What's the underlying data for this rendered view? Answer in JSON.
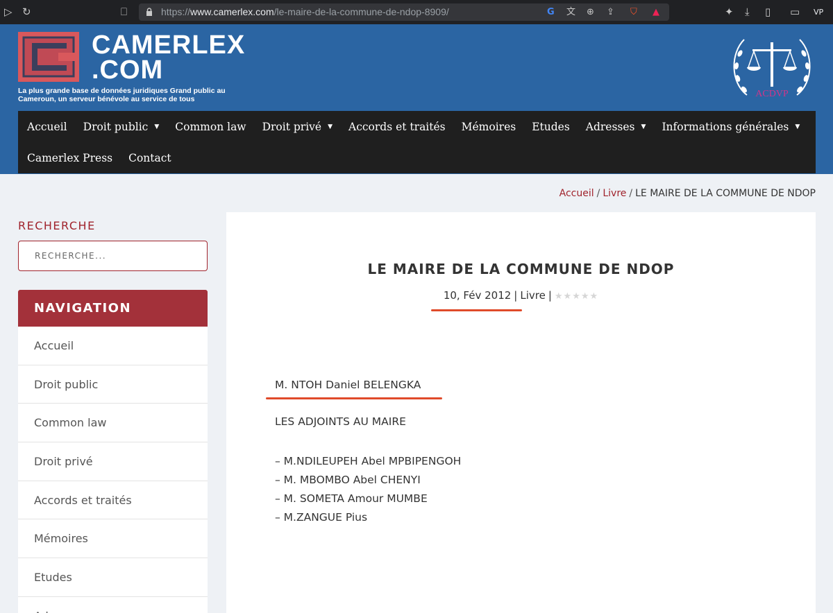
{
  "browser": {
    "url_prefix": "https://",
    "url_domain": "www.camerlex.com",
    "url_path": "/le-maire-de-la-commune-de-ndop-8909/",
    "profile_label": "VP"
  },
  "header": {
    "logo_line1": "CAMERLEX",
    "logo_line2": ".COM",
    "tagline": "La plus grande base de données juridiques Grand public au Cameroun, un serveur bénévole au service de tous",
    "seal_text": "ACDVP"
  },
  "nav": {
    "row1": [
      {
        "label": "Accueil",
        "dropdown": false
      },
      {
        "label": "Droit public",
        "dropdown": true
      },
      {
        "label": "Common law",
        "dropdown": false
      },
      {
        "label": "Droit privé",
        "dropdown": true
      },
      {
        "label": "Accords et traités",
        "dropdown": false
      },
      {
        "label": "Mémoires",
        "dropdown": false
      },
      {
        "label": "Etudes",
        "dropdown": false
      },
      {
        "label": "Adresses",
        "dropdown": true
      },
      {
        "label": "Informations générales",
        "dropdown": true
      }
    ],
    "row2": [
      {
        "label": "Camerlex Press",
        "dropdown": false
      },
      {
        "label": "Contact",
        "dropdown": false
      }
    ]
  },
  "breadcrumb": {
    "home": "Accueil",
    "category": "Livre",
    "separator": "/",
    "current": "LE MAIRE DE LA COMMUNE DE NDOP"
  },
  "sidebar": {
    "search_heading": "RECHERCHE",
    "search_placeholder": "RECHERCHE...",
    "nav_heading": "NAVIGATION",
    "items": [
      "Accueil",
      "Droit public",
      "Common law",
      "Droit privé",
      "Accords et traités",
      "Mémoires",
      "Etudes",
      "Adresses"
    ]
  },
  "article": {
    "title": "LE MAIRE DE LA COMMUNE DE NDOP",
    "date": "10, Fév 2012",
    "category": "Livre",
    "meta_separator": "|",
    "rating": {
      "value": 0,
      "max": 5
    },
    "mayor": "M. NTOH Daniel BELENGKA",
    "deputies_heading": "LES ADJOINTS AU MAIRE",
    "deputies": [
      "– M.NDILEUPEH Abel MPBIPENGOH",
      "– M. MBOMBO Abel CHENYI",
      "– M. SOMETA Amour MUMBE",
      "– M.ZANGUE Pius"
    ]
  },
  "colors": {
    "header_blue": "#2b65a3",
    "nav_dark": "#1f1f1f",
    "accent_red": "#a3313a",
    "annotation_orange": "#e04a2a"
  }
}
